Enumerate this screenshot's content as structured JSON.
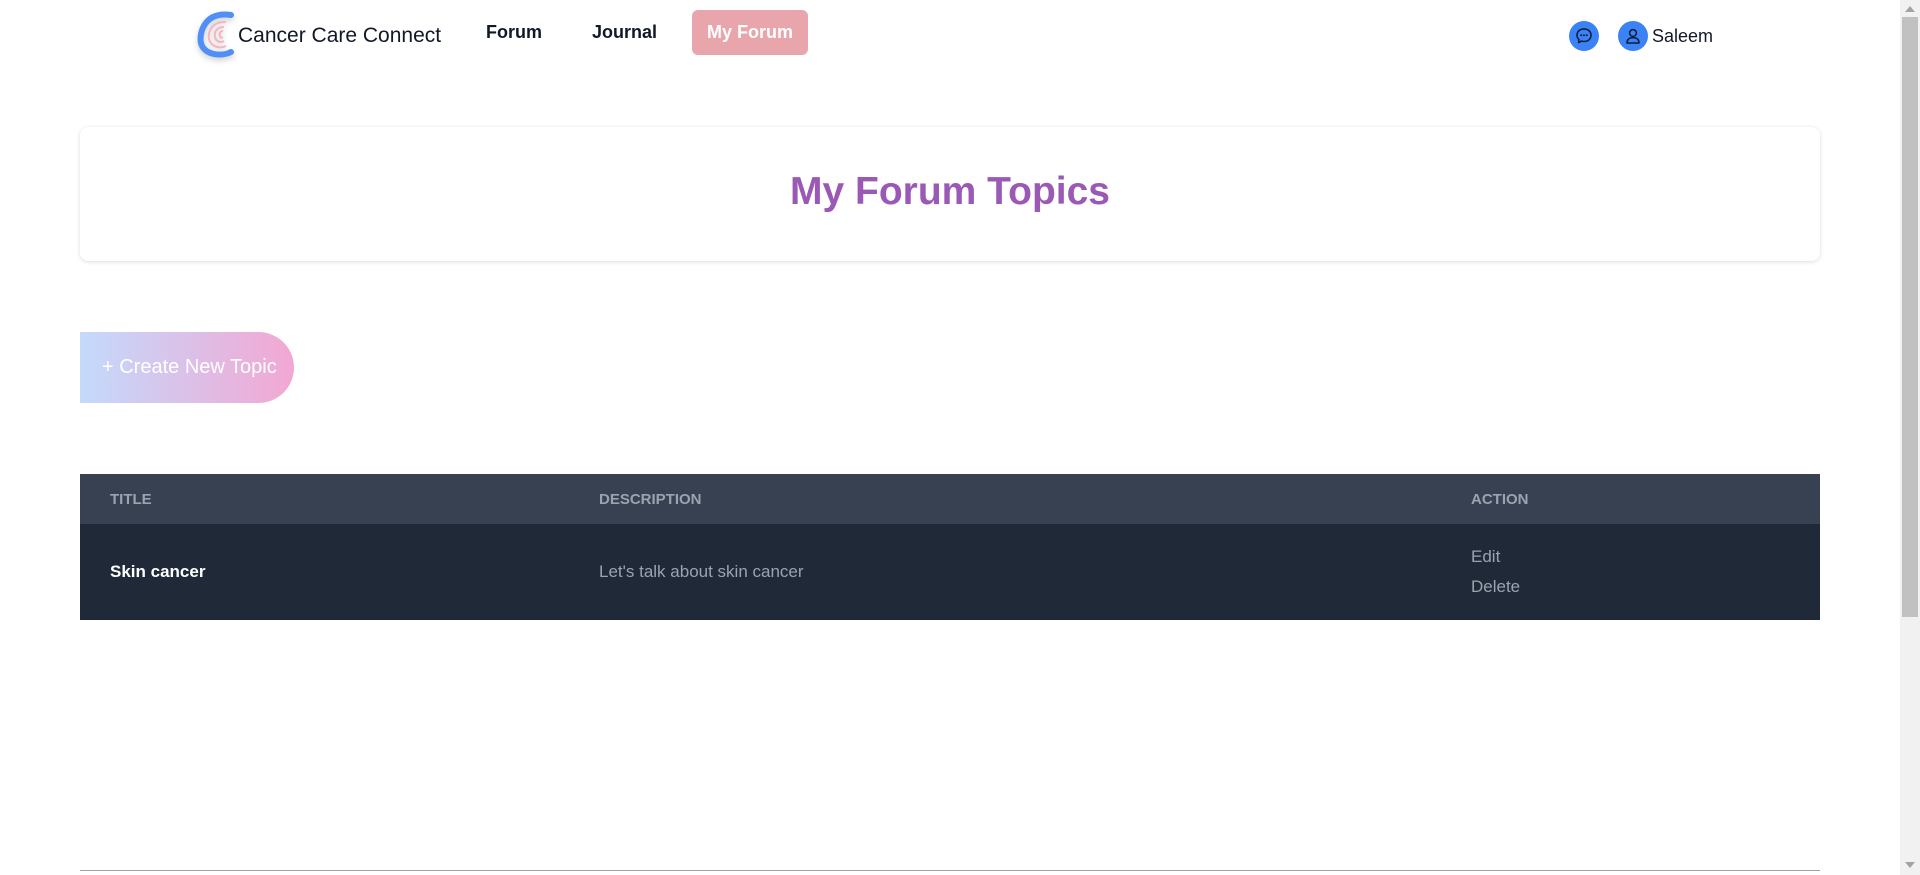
{
  "header": {
    "brand_name": "Cancer Care Connect",
    "nav": [
      {
        "label": "Forum",
        "active": false
      },
      {
        "label": "Journal",
        "active": false
      },
      {
        "label": "My Forum",
        "active": true
      }
    ],
    "user_name": "Saleem"
  },
  "main": {
    "page_title": "My Forum Topics",
    "create_button_label": "+ Create New Topic",
    "table": {
      "columns": [
        "Title",
        "Description",
        "Action"
      ],
      "rows": [
        {
          "title": "Skin cancer",
          "description": "Let's talk about skin cancer",
          "actions": [
            "Edit",
            "Delete"
          ]
        }
      ]
    }
  },
  "icons": {
    "logo": "brand-logo-icon",
    "chat": "chat-bubble-icon",
    "user": "user-icon"
  },
  "colors": {
    "accent_nav_active": "#e8a5ab",
    "title_purple": "#9b59b6",
    "icon_blue": "#3b82f6",
    "table_header": "#374151",
    "table_row": "#1f2937",
    "button_gradient_start": "#c3dafc",
    "button_gradient_end": "#f3a7d3"
  }
}
